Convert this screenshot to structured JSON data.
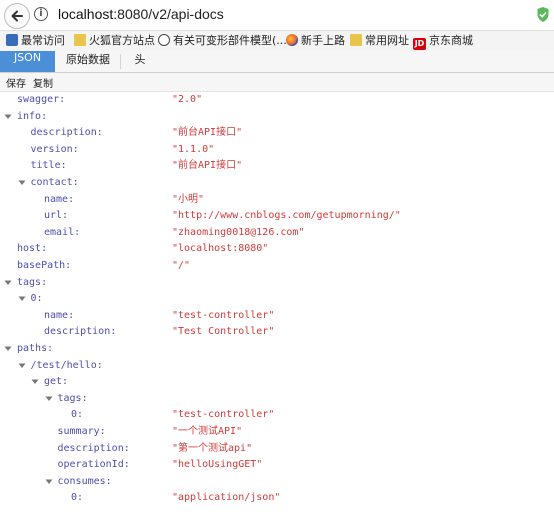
{
  "browser": {
    "url_host": "localhost",
    "url_rest": ":8080/v2/api-docs"
  },
  "bookmarks": [
    {
      "label": "最常访问",
      "icon": "book-icon"
    },
    {
      "label": "火狐官方站点",
      "icon": "folder-icon"
    },
    {
      "label": "有关可变形部件模型(...",
      "icon": "globe-icon"
    },
    {
      "label": "新手上路",
      "icon": "firefox-icon"
    },
    {
      "label": "常用网址",
      "icon": "folder-icon"
    },
    {
      "label": "京东商城",
      "icon": "jd-icon"
    }
  ],
  "tabs": [
    "JSON",
    "原始数据",
    "头"
  ],
  "toolbar": {
    "save": "保存",
    "copy": "复制"
  },
  "colors": {
    "key": "#4d4fb0",
    "string": "#d23a3a",
    "active_tab": "#4a8fd8"
  },
  "tree": [
    {
      "key": "swagger:",
      "value": "\"2.0\"",
      "level": 0,
      "toggle": false
    },
    {
      "key": "info:",
      "value": "",
      "level": 0,
      "toggle": true
    },
    {
      "key": "description:",
      "value": "\"前台API接口\"",
      "level": 1,
      "toggle": false
    },
    {
      "key": "version:",
      "value": "\"1.1.0\"",
      "level": 1,
      "toggle": false
    },
    {
      "key": "title:",
      "value": "\"前台API接口\"",
      "level": 1,
      "toggle": false
    },
    {
      "key": "contact:",
      "value": "",
      "level": 1,
      "toggle": true
    },
    {
      "key": "name:",
      "value": "\"小明\"",
      "level": 2,
      "toggle": false
    },
    {
      "key": "url:",
      "value": "\"http://www.cnblogs.com/getupmorning/\"",
      "level": 2,
      "toggle": false
    },
    {
      "key": "email:",
      "value": "\"zhaoming0018@126.com\"",
      "level": 2,
      "toggle": false
    },
    {
      "key": "host:",
      "value": "\"localhost:8080\"",
      "level": 0,
      "toggle": false
    },
    {
      "key": "basePath:",
      "value": "\"/\"",
      "level": 0,
      "toggle": false
    },
    {
      "key": "tags:",
      "value": "",
      "level": 0,
      "toggle": true
    },
    {
      "key": "0:",
      "value": "",
      "level": 1,
      "toggle": true
    },
    {
      "key": "name:",
      "value": "\"test-controller\"",
      "level": 2,
      "toggle": false
    },
    {
      "key": "description:",
      "value": "\"Test Controller\"",
      "level": 2,
      "toggle": false
    },
    {
      "key": "paths:",
      "value": "",
      "level": 0,
      "toggle": true
    },
    {
      "key": "/test/hello:",
      "value": "",
      "level": 1,
      "toggle": true
    },
    {
      "key": "get:",
      "value": "",
      "level": 2,
      "toggle": true
    },
    {
      "key": "tags:",
      "value": "",
      "level": 3,
      "toggle": true
    },
    {
      "key": "0:",
      "value": "\"test-controller\"",
      "level": 4,
      "toggle": false
    },
    {
      "key": "summary:",
      "value": "\"一个测试API\"",
      "level": 3,
      "toggle": false
    },
    {
      "key": "description:",
      "value": "\"第一个测试api\"",
      "level": 3,
      "toggle": false
    },
    {
      "key": "operationId:",
      "value": "\"helloUsingGET\"",
      "level": 3,
      "toggle": false
    },
    {
      "key": "consumes:",
      "value": "",
      "level": 3,
      "toggle": true
    },
    {
      "key": "0:",
      "value": "\"application/json\"",
      "level": 4,
      "toggle": false
    }
  ]
}
